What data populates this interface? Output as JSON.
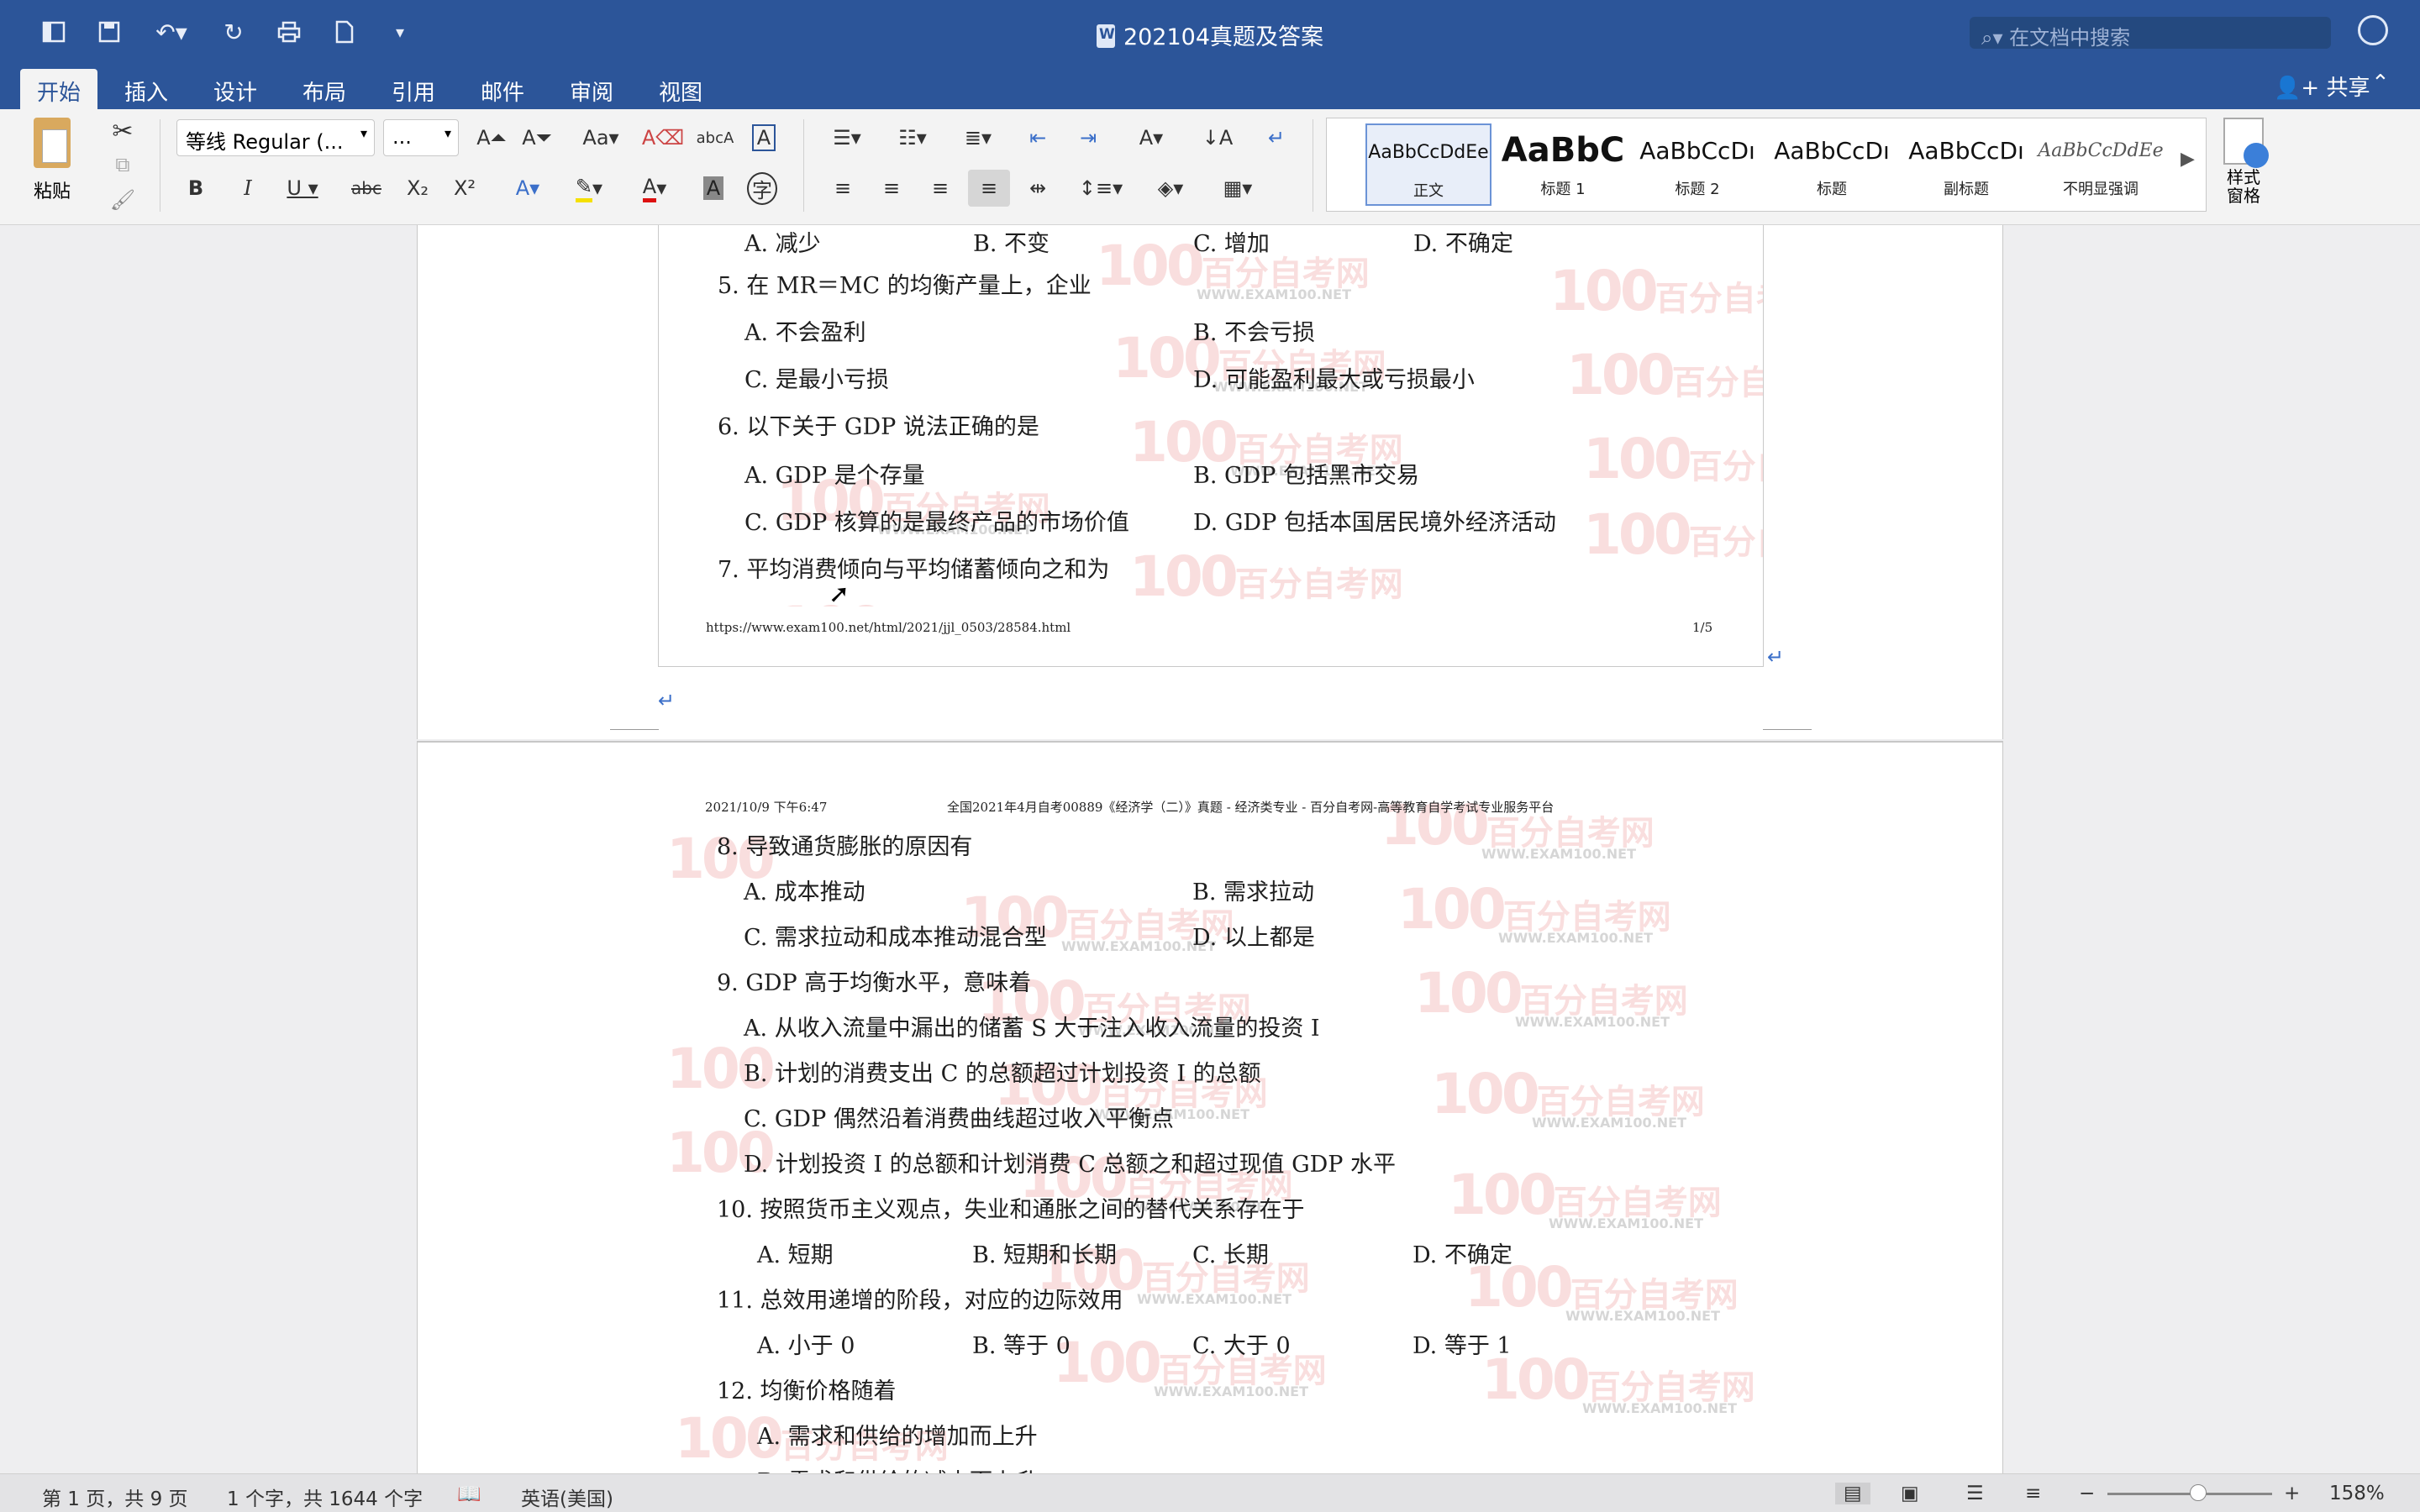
{
  "window": {
    "title": "202104真题及答案",
    "search_placeholder": "在文档中搜索"
  },
  "tabs": [
    "开始",
    "插入",
    "设计",
    "布局",
    "引用",
    "邮件",
    "审阅",
    "视图"
  ],
  "share_label": "共享",
  "ribbon": {
    "paste_label": "粘贴",
    "font_name": "等线 Regular (...",
    "font_size": "...",
    "styles": [
      {
        "preview": "AaBbCcDdEe",
        "name": "正文"
      },
      {
        "preview": "AaBbC",
        "name": "标题 1"
      },
      {
        "preview": "AaBbCcDı",
        "name": "标题 2"
      },
      {
        "preview": "AaBbCcDı",
        "name": "标题"
      },
      {
        "preview": "AaBbCcDı",
        "name": "副标题"
      },
      {
        "preview": "AaBbCcDdEe",
        "name": "不明显强调"
      }
    ],
    "styles_pane_label": "样式\n窗格"
  },
  "page1": {
    "lines": [
      {
        "text": "A. 减少",
        "x": 0
      },
      {
        "text": "B. 不变",
        "x": 1
      },
      {
        "text": "C. 增加",
        "x": 2
      },
      {
        "text": "D. 不确定",
        "x": 3
      },
      "5. 在 MR＝MC 的均衡产量上，企业",
      "A. 不会盈利|B. 不会亏损",
      "C. 是最小亏损|D. 可能盈利最大或亏损最小",
      "6. 以下关于 GDP 说法正确的是",
      "A. GDP 是个存量|B. GDP 包括黑市交易",
      "C. GDP 核算的是最终产品的市场价值|D. GDP 包括本国居民境外经济活动",
      "7. 平均消费倾向与平均储蓄倾向之和为"
    ],
    "footer_url": "https://www.exam100.net/html/2021/jjl_0503/28584.html",
    "footer_page": "1/5"
  },
  "page2": {
    "header_left": "2021/10/9 下午6:47",
    "header_right": "全国2021年4月自考00889《经济学（二）》真题 - 经济类专业 - 百分自考网-高等教育自学考试专业服务平台",
    "q8": "8. 导致通货膨胀的原因有",
    "q8a": "A. 成本推动",
    "q8b": "B. 需求拉动",
    "q8c": "C. 需求拉动和成本推动混合型",
    "q8d": "D. 以上都是",
    "q9": "9. GDP 高于均衡水平，意味着",
    "q9a": "A. 从收入流量中漏出的储蓄 S 大于注入收入流量的投资 I",
    "q9b": "B. 计划的消费支出 C 的总额超过计划投资 I 的总额",
    "q9c": "C. GDP 偶然沿着消费曲线超过收入平衡点",
    "q9d": "D. 计划投资 I 的总额和计划消费 C 总额之和超过现值 GDP 水平",
    "q10": "10. 按照货币主义观点，失业和通胀之间的替代关系存在于",
    "q10a": "A. 短期",
    "q10b": "B. 短期和长期",
    "q10c": "C. 长期",
    "q10d": "D. 不确定",
    "q11": "11. 总效用递增的阶段，对应的边际效用",
    "q11a": "A. 小于 0",
    "q11b": "B. 等于 0",
    "q11c": "C. 大于 0",
    "q11d": "D. 等于 1",
    "q12": "12. 均衡价格随着",
    "q12a": "A. 需求和供给的增加而上升",
    "q12b": "B. 需求和供给的减少而上升"
  },
  "p1": {
    "q4a": "A. 减少",
    "q4b": "B. 不变",
    "q4c": "C. 增加",
    "q4d": "D. 不确定",
    "q5": "5. 在 MR＝MC 的均衡产量上，企业",
    "q5a": "A. 不会盈利",
    "q5b": "B. 不会亏损",
    "q5c": "C. 是最小亏损",
    "q5d": "D. 可能盈利最大或亏损最小",
    "q6": "6. 以下关于 GDP 说法正确的是",
    "q6a": "A. GDP 是个存量",
    "q6b": "B. GDP 包括黑市交易",
    "q6c": "C. GDP 核算的是最终产品的市场价值",
    "q6d": "D. GDP 包括本国居民境外经济活动",
    "q7": "7. 平均消费倾向与平均储蓄倾向之和为"
  },
  "watermark": {
    "logo": "100",
    "brand": "百分自考网",
    "url": "WWW.EXAM100.NET"
  },
  "status": {
    "page": "第 1 页，共 9 页",
    "words": "1 个字，共 1644 个字",
    "language": "英语(美国)",
    "zoom": "158%"
  }
}
